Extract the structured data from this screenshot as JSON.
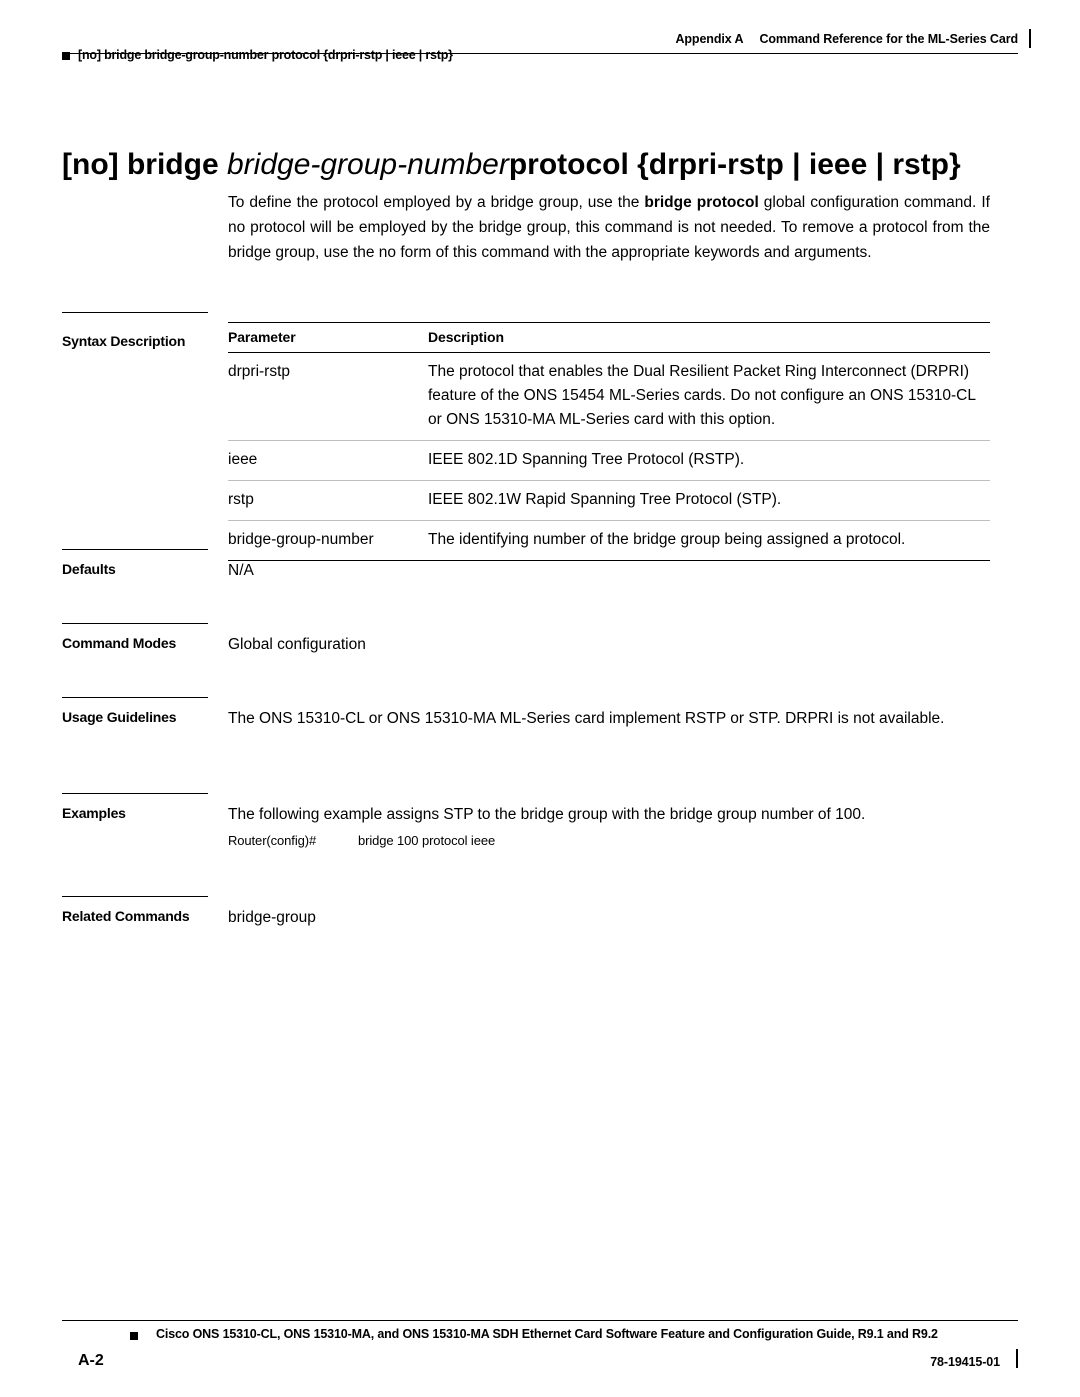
{
  "header": {
    "left_text": "[no] bridge bridge-group-number protocol {drpri-rstp | ieee | rstp}",
    "appendix_label": "Appendix A",
    "appendix_title": "Command Reference for the ML-Series Card"
  },
  "title": {
    "part_no": "[no] bridge",
    "part_arg": "bridge-group-number",
    "part_protocol": "protocol {drpri-rstp | ieee | rstp}"
  },
  "intro": {
    "line1_a": "To define the protocol employed by a bridge group, use the ",
    "line1_b": "bridge protocol",
    "line1_c": " global configuration",
    "line2_a": "command. If no protocol will be employed by the bridge group, this command is not needed. To remove",
    "line3": "a protocol from the bridge group, use the no form of this command with the appropriate keywords and",
    "line4": "arguments."
  },
  "sections": {
    "syntax_description": {
      "label": "Syntax Description",
      "columns": [
        "Parameter",
        "Description"
      ],
      "rows": [
        {
          "parameter": "drpri-rstp",
          "description": "The protocol that enables the Dual Resilient Packet Ring Interconnect (DRPRI) feature of the ONS 15454 ML-Series cards. Do not configure an ONS 15310-CL or ONS 15310-MA ML-Series card with this option."
        },
        {
          "parameter": "ieee",
          "description": "IEEE 802.1D Spanning Tree Protocol (RSTP)."
        },
        {
          "parameter": "rstp",
          "description": "IEEE 802.1W Rapid Spanning Tree Protocol (STP)."
        },
        {
          "parameter": "bridge-group-number",
          "description": "The identifying number of the bridge group being assigned a protocol."
        }
      ]
    },
    "defaults": {
      "label": "Defaults",
      "body": "N/A"
    },
    "command_modes": {
      "label": "Command Modes",
      "body": "Global configuration"
    },
    "usage_guidelines": {
      "label": "Usage Guidelines",
      "body": "The ONS 15310-CL or ONS 15310-MA ML-Series card implement RSTP or STP. DRPRI is not available."
    },
    "examples": {
      "label": "Examples",
      "body": "The following example assigns STP to the bridge group with the bridge group number of 100.",
      "cli_prompt": "Router(config)#",
      "cli_command": "bridge 100 protocol ieee"
    },
    "related_commands": {
      "label": "Related Commands",
      "body": "bridge-group"
    }
  },
  "footer": {
    "title": "Cisco ONS 15310-CL, ONS 15310-MA, and ONS 15310-MA SDH Ethernet Card Software Feature and Configuration Guide, R9.1 and R9.2",
    "page_number": "A-2",
    "doc_number": "78-19415-01"
  }
}
